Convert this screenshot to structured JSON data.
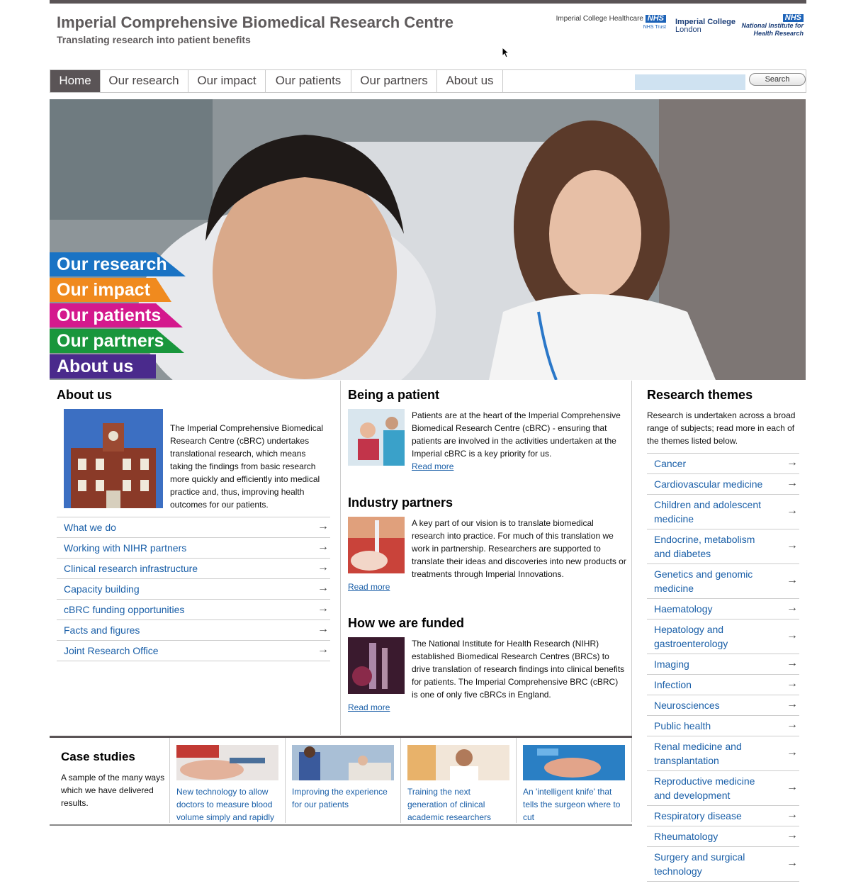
{
  "header": {
    "title": "Imperial Comprehensive Biomedical Research Centre",
    "subtitle": "Translating research into patient benefits",
    "logos": {
      "ich_line1": "Imperial College Healthcare",
      "ich_nhs": "NHS",
      "ich_line2": "NHS Trust",
      "icl_line1": "Imperial College",
      "icl_line2": "London",
      "nihr_nhs": "NHS",
      "nihr_line1": "National Institute for",
      "nihr_line2": "Health Research"
    }
  },
  "nav": {
    "items": [
      "Home",
      "Our research",
      "Our impact",
      "Our patients",
      "Our partners",
      "About us"
    ],
    "search_button": "Search",
    "search_placeholder": ""
  },
  "hero": {
    "tabs": [
      {
        "label": "Our research",
        "color": "#1a73c4"
      },
      {
        "label": "Our impact",
        "color": "#f08a1e"
      },
      {
        "label": "Our patients",
        "color": "#d4198d"
      },
      {
        "label": "Our partners",
        "color": "#19963c"
      },
      {
        "label": "About us",
        "color": "#4a2a8c"
      }
    ]
  },
  "about": {
    "title": "About us",
    "text": "The Imperial Comprehensive Biomedical Research Centre (cBRC) undertakes translational research, which means taking the findings from basic research more quickly and efficiently into medical practice and, thus, improving health outcomes for our patients.",
    "links": [
      "What we do",
      "Working with NIHR partners",
      "Clinical research infrastructure",
      "Capacity building",
      "cBRC funding opportunities",
      "Facts and figures",
      "Joint Research Office"
    ]
  },
  "middle": {
    "patient": {
      "title": "Being a patient",
      "text": "Patients are at the heart of the Imperial Comprehensive Biomedical Research Centre (cBRC) - ensuring that patients are involved in the activities undertaken at the Imperial cBRC is a key priority for us.",
      "read_more": "Read more"
    },
    "industry": {
      "title": "Industry partners",
      "text": "A key part of our vision is to translate biomedical research into practice. For much of this translation we work in partnership. Researchers are supported to translate their ideas and discoveries into new products or treatments through Imperial Innovations.",
      "read_more": "Read more"
    },
    "funded": {
      "title": "How we are funded",
      "text": "The National Institute for Health Research (NIHR) established Biomedical Research Centres (BRCs) to drive translation of research findings into clinical benefits for patients. The Imperial Comprehensive BRC (cBRC) is one of only five cBRCs in England.",
      "read_more": "Read more"
    }
  },
  "themes": {
    "title": "Research themes",
    "intro": "Research is undertaken across a broad range of subjects; read more in each of the themes listed below.",
    "items": [
      "Cancer",
      "Cardiovascular medicine",
      "Children and adolescent medicine",
      "Endocrine, metabolism and diabetes",
      "Genetics and genomic medicine",
      "Haematology",
      "Hepatology and gastroenterology",
      "Imaging",
      "Infection",
      "Neurosciences",
      "Public health",
      "Renal medicine and transplantation",
      "Reproductive medicine and development",
      "Respiratory disease",
      "Rheumatology",
      "Surgery and surgical technology"
    ]
  },
  "cases": {
    "title": "Case studies",
    "intro": "A sample of the many ways which we have delivered results.",
    "items": [
      "New technology to allow doctors to measure blood volume simply and rapidly",
      "Improving the experience for our patients",
      "Training the next generation of clinical academic researchers",
      "An 'intelligent knife' that tells the surgeon where to cut"
    ]
  },
  "icons": {
    "arrow": "→"
  }
}
